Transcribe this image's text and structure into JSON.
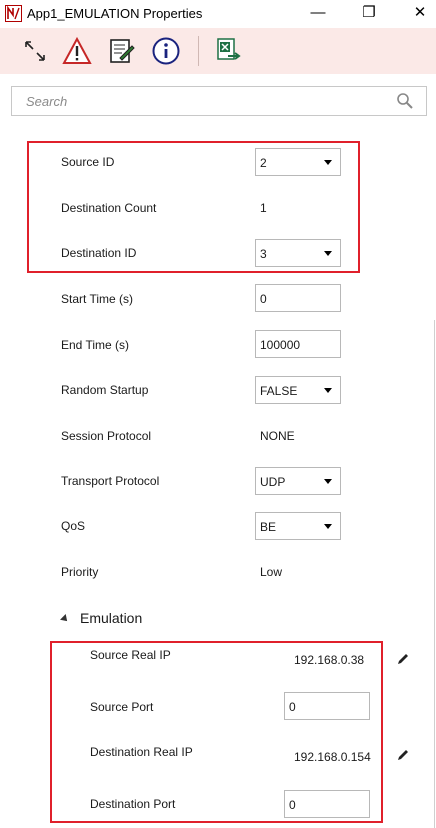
{
  "window": {
    "title": "App1_EMULATION Properties",
    "controls": {
      "minimize": "—",
      "restore": "❐",
      "close": "✕"
    }
  },
  "toolbar": {
    "icons": [
      "expand-collapse-icon",
      "warning-icon",
      "notes-icon",
      "info-icon",
      "excel-export-icon"
    ]
  },
  "search": {
    "placeholder": "Search"
  },
  "properties": {
    "source_id": {
      "label": "Source ID",
      "value": "2"
    },
    "destination_count": {
      "label": "Destination Count",
      "value": "1"
    },
    "destination_id": {
      "label": "Destination ID",
      "value": "3"
    },
    "start_time": {
      "label": "Start Time (s)",
      "value": "0"
    },
    "end_time": {
      "label": "End Time (s)",
      "value": "100000"
    },
    "random_startup": {
      "label": "Random Startup",
      "value": "FALSE"
    },
    "session_protocol": {
      "label": "Session Protocol",
      "value": "NONE"
    },
    "transport_protocol": {
      "label": "Transport Protocol",
      "value": "UDP"
    },
    "qos": {
      "label": "QoS",
      "value": "BE"
    },
    "priority": {
      "label": "Priority",
      "value": "Low"
    }
  },
  "emulation": {
    "heading": "Emulation",
    "source_real_ip": {
      "label": "Source Real IP",
      "value": "192.168.0.38"
    },
    "source_port": {
      "label": "Source Port",
      "value": "0"
    },
    "destination_real_ip": {
      "label": "Destination Real IP",
      "value": "192.168.0.154"
    },
    "destination_port": {
      "label": "Destination Port",
      "value": "0"
    }
  },
  "colors": {
    "toolbar_bg": "#fbe9e7",
    "highlight_red": "#e0202b",
    "excel_green": "#1e7145"
  }
}
